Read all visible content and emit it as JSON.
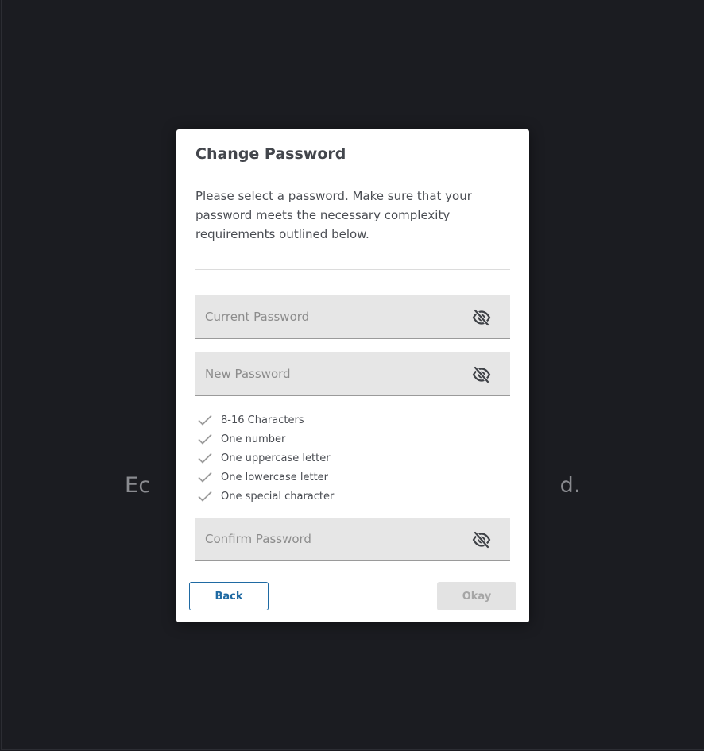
{
  "background": {
    "text": "Ec                                                          d."
  },
  "modal": {
    "title": "Change Password",
    "description": "Please select a password. Make sure that your password meets the necessary complexity requirements outlined below."
  },
  "fields": {
    "current_password": {
      "placeholder": "Current Password",
      "value": ""
    },
    "new_password": {
      "placeholder": "New Password",
      "value": ""
    },
    "confirm_password": {
      "placeholder": "Confirm Password",
      "value": ""
    }
  },
  "requirements": [
    {
      "label": "8-16 Characters",
      "icon": "check-icon"
    },
    {
      "label": "One number",
      "icon": "check-icon"
    },
    {
      "label": "One uppercase letter",
      "icon": "check-icon"
    },
    {
      "label": "One lowercase letter",
      "icon": "check-icon"
    },
    {
      "label": "One special character",
      "icon": "check-icon"
    }
  ],
  "buttons": {
    "back_label": "Back",
    "okay_label": "Okay"
  },
  "colors": {
    "primary": "#1f6aa3",
    "overlay": "#1b1c21",
    "disabled_bg": "#e3e3e3",
    "field_bg": "#e6e6e6"
  }
}
